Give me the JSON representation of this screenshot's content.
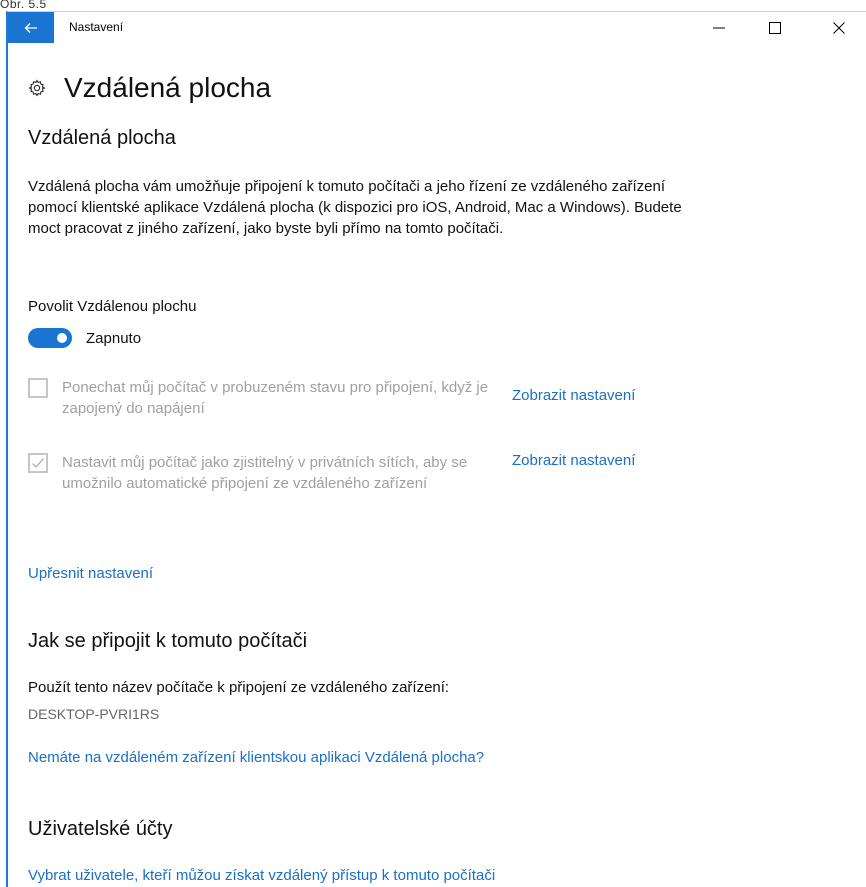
{
  "outer_label": "Obr. 5.5",
  "titlebar": {
    "back": "←",
    "app_title": "Nastavení",
    "minimize": "—",
    "maximize": "☐",
    "close": "✕"
  },
  "page": {
    "title": "Vzdálená plocha",
    "section1_heading": "Vzdálená plocha",
    "section1_description": "Vzdálená plocha vám umožňuje připojení k tomuto počítači a jeho řízení ze vzdáleného zařízení pomocí klientské aplikace Vzdálená plocha (k dispozici pro iOS, Android, Mac a Windows). Budete moct pracovat z jiného zařízení, jako byste byli přímo na tomto počítači.",
    "enable_label": "Povolit Vzdálenou plochu",
    "toggle_state": "Zapnuto",
    "option1_text": "Ponechat můj počítač v probuzeném stavu pro připojení, když je zapojený do napájení",
    "option1_link": "Zobrazit nastavení",
    "option2_text": "Nastavit můj počítač jako zjistitelný v privátních sítích, aby se umožnilo automatické připojení ze vzdáleného zařízení",
    "option2_link": "Zobrazit nastavení",
    "advanced_link": "Upřesnit nastavení",
    "section2_heading": "Jak se připojit k tomuto počítači",
    "connect_label": "Použít tento název počítače k připojení ze vzdáleného zařízení:",
    "pc_name": "DESKTOP-PVRI1RS",
    "client_app_link": "Nemáte na vzdáleném zařízení klientskou aplikaci Vzdálená plocha?",
    "section3_heading": "Uživatelské účty",
    "select_users_link": "Vybrat uživatele, kteří můžou získat vzdálený přístup k tomuto počítači"
  },
  "colors": {
    "accent": "#1a74d2",
    "link": "#1a6fc8",
    "disabled_text": "#a0a0a0"
  }
}
